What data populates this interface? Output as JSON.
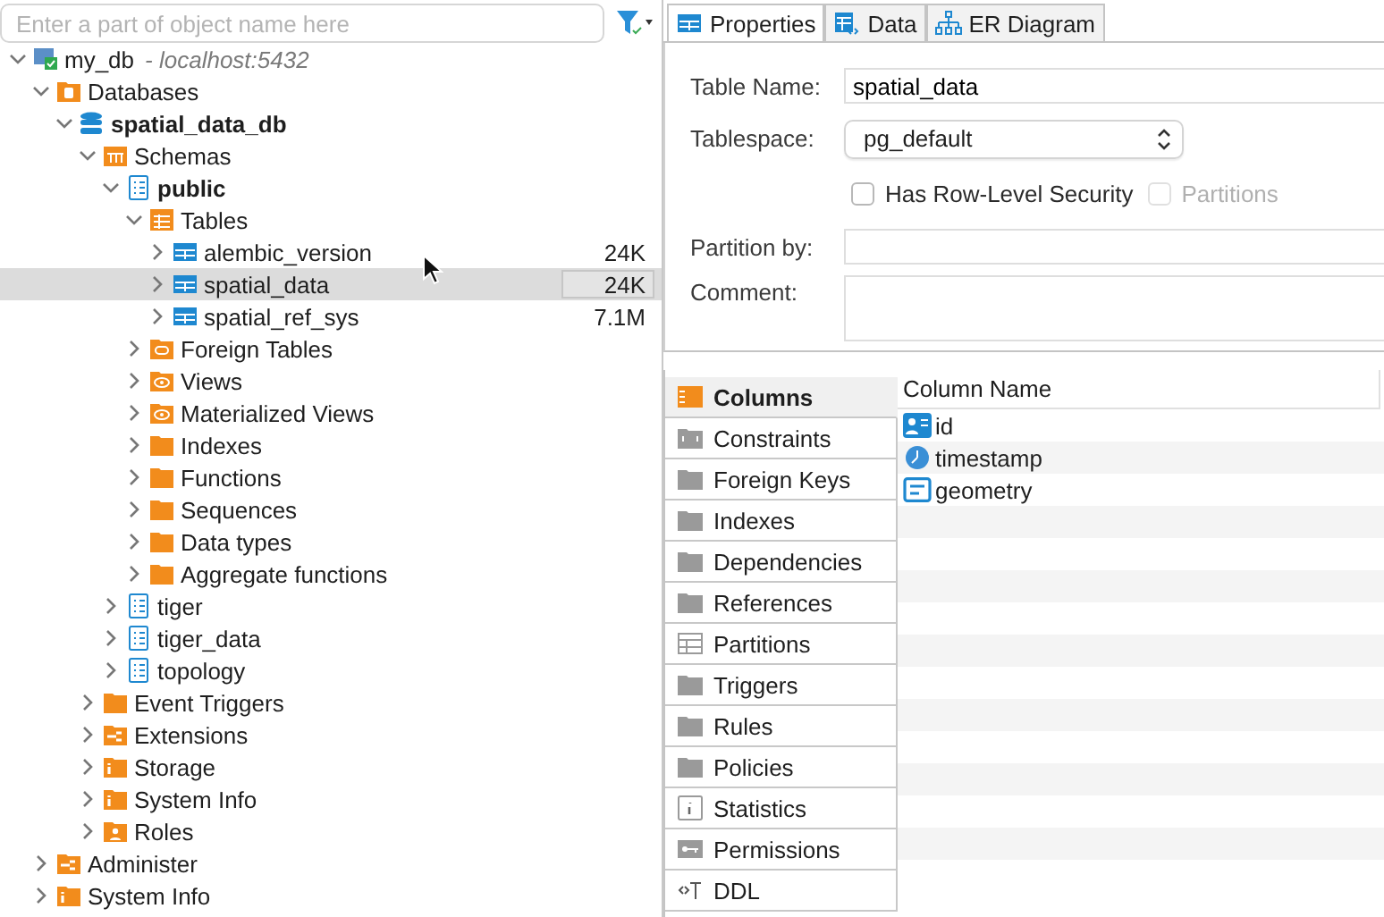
{
  "navigator": {
    "search": {
      "placeholder": "Enter a part of object name here"
    },
    "tree": [
      {
        "label": "my_db",
        "note": "- localhost:5432",
        "kind": "server",
        "expanded": true,
        "selected": false,
        "bold": false,
        "children": [
          {
            "label": "Databases",
            "kind": "dbfolder",
            "expanded": true,
            "selected": false,
            "bold": false,
            "children": [
              {
                "label": "spatial_data_db",
                "kind": "database",
                "expanded": true,
                "selected": false,
                "bold": true,
                "children": [
                  {
                    "label": "Schemas",
                    "kind": "schemas",
                    "expanded": true,
                    "selected": false,
                    "bold": false,
                    "children": [
                      {
                        "label": "public",
                        "kind": "schema",
                        "expanded": true,
                        "selected": false,
                        "bold": true,
                        "children": [
                          {
                            "label": "Tables",
                            "kind": "tables",
                            "expanded": true,
                            "selected": false,
                            "bold": false,
                            "children": [
                              {
                                "label": "alembic_version",
                                "kind": "table",
                                "expanded": false,
                                "selected": false,
                                "bold": false,
                                "size": "24K"
                              },
                              {
                                "label": "spatial_data",
                                "kind": "table",
                                "expanded": false,
                                "selected": true,
                                "bold": false,
                                "size": "24K"
                              },
                              {
                                "label": "spatial_ref_sys",
                                "kind": "table",
                                "expanded": false,
                                "selected": false,
                                "bold": false,
                                "size": "7.1M"
                              }
                            ]
                          },
                          {
                            "label": "Foreign Tables",
                            "kind": "foreign",
                            "expanded": false,
                            "selected": false,
                            "bold": false
                          },
                          {
                            "label": "Views",
                            "kind": "views",
                            "expanded": false,
                            "selected": false,
                            "bold": false
                          },
                          {
                            "label": "Materialized Views",
                            "kind": "views",
                            "expanded": false,
                            "selected": false,
                            "bold": false
                          },
                          {
                            "label": "Indexes",
                            "kind": "folder",
                            "expanded": false,
                            "selected": false,
                            "bold": false
                          },
                          {
                            "label": "Functions",
                            "kind": "folder",
                            "expanded": false,
                            "selected": false,
                            "bold": false
                          },
                          {
                            "label": "Sequences",
                            "kind": "folder",
                            "expanded": false,
                            "selected": false,
                            "bold": false
                          },
                          {
                            "label": "Data types",
                            "kind": "folder",
                            "expanded": false,
                            "selected": false,
                            "bold": false
                          },
                          {
                            "label": "Aggregate functions",
                            "kind": "folder",
                            "expanded": false,
                            "selected": false,
                            "bold": false
                          }
                        ]
                      },
                      {
                        "label": "tiger",
                        "kind": "schema",
                        "expanded": false,
                        "selected": false,
                        "bold": false
                      },
                      {
                        "label": "tiger_data",
                        "kind": "schema",
                        "expanded": false,
                        "selected": false,
                        "bold": false
                      },
                      {
                        "label": "topology",
                        "kind": "schema",
                        "expanded": false,
                        "selected": false,
                        "bold": false
                      }
                    ]
                  },
                  {
                    "label": "Event Triggers",
                    "kind": "folder",
                    "expanded": false,
                    "selected": false,
                    "bold": false
                  },
                  {
                    "label": "Extensions",
                    "kind": "extension",
                    "expanded": false,
                    "selected": false,
                    "bold": false
                  },
                  {
                    "label": "Storage",
                    "kind": "info",
                    "expanded": false,
                    "selected": false,
                    "bold": false
                  },
                  {
                    "label": "System Info",
                    "kind": "info",
                    "expanded": false,
                    "selected": false,
                    "bold": false
                  },
                  {
                    "label": "Roles",
                    "kind": "roles",
                    "expanded": false,
                    "selected": false,
                    "bold": false
                  }
                ]
              }
            ]
          },
          {
            "label": "Administer",
            "kind": "extension",
            "expanded": false,
            "selected": false,
            "bold": false
          },
          {
            "label": "System Info",
            "kind": "info",
            "expanded": false,
            "selected": false,
            "bold": false
          }
        ]
      }
    ]
  },
  "editor": {
    "tabs": [
      {
        "label": "Properties",
        "kind": "table",
        "selected": true
      },
      {
        "label": "Data",
        "kind": "data",
        "selected": false
      },
      {
        "label": "ER Diagram",
        "kind": "er",
        "selected": false
      }
    ],
    "properties": {
      "table_name": {
        "label": "Table Name:",
        "value": "spatial_data"
      },
      "tablespace": {
        "label": "Tablespace:",
        "value": "pg_default"
      },
      "checkboxes": [
        {
          "label": "Has Row-Level Security",
          "checked": false,
          "disabled": false
        },
        {
          "label": "Partitions",
          "checked": false,
          "disabled": true
        }
      ],
      "partition_by": {
        "label": "Partition by:"
      },
      "comment": {
        "label": "Comment:"
      }
    },
    "sections": [
      {
        "label": "Columns",
        "kind": "columns",
        "selected": true
      },
      {
        "label": "Constraints",
        "kind": "constraint",
        "selected": false
      },
      {
        "label": "Foreign Keys",
        "kind": "folder",
        "selected": false
      },
      {
        "label": "Indexes",
        "kind": "folder",
        "selected": false
      },
      {
        "label": "Dependencies",
        "kind": "folder",
        "selected": false
      },
      {
        "label": "References",
        "kind": "folder",
        "selected": false
      },
      {
        "label": "Partitions",
        "kind": "partitions",
        "selected": false
      },
      {
        "label": "Triggers",
        "kind": "folder",
        "selected": false
      },
      {
        "label": "Rules",
        "kind": "folder",
        "selected": false
      },
      {
        "label": "Policies",
        "kind": "folder",
        "selected": false
      },
      {
        "label": "Statistics",
        "kind": "stats",
        "selected": false
      },
      {
        "label": "Permissions",
        "kind": "key",
        "selected": false
      },
      {
        "label": "DDL",
        "kind": "ddl",
        "selected": false
      }
    ],
    "columns_grid": {
      "header": "Column Name",
      "rows": [
        {
          "name": "id",
          "kind": "id"
        },
        {
          "name": "timestamp",
          "kind": "time"
        },
        {
          "name": "geometry",
          "kind": "geometry"
        }
      ]
    }
  }
}
